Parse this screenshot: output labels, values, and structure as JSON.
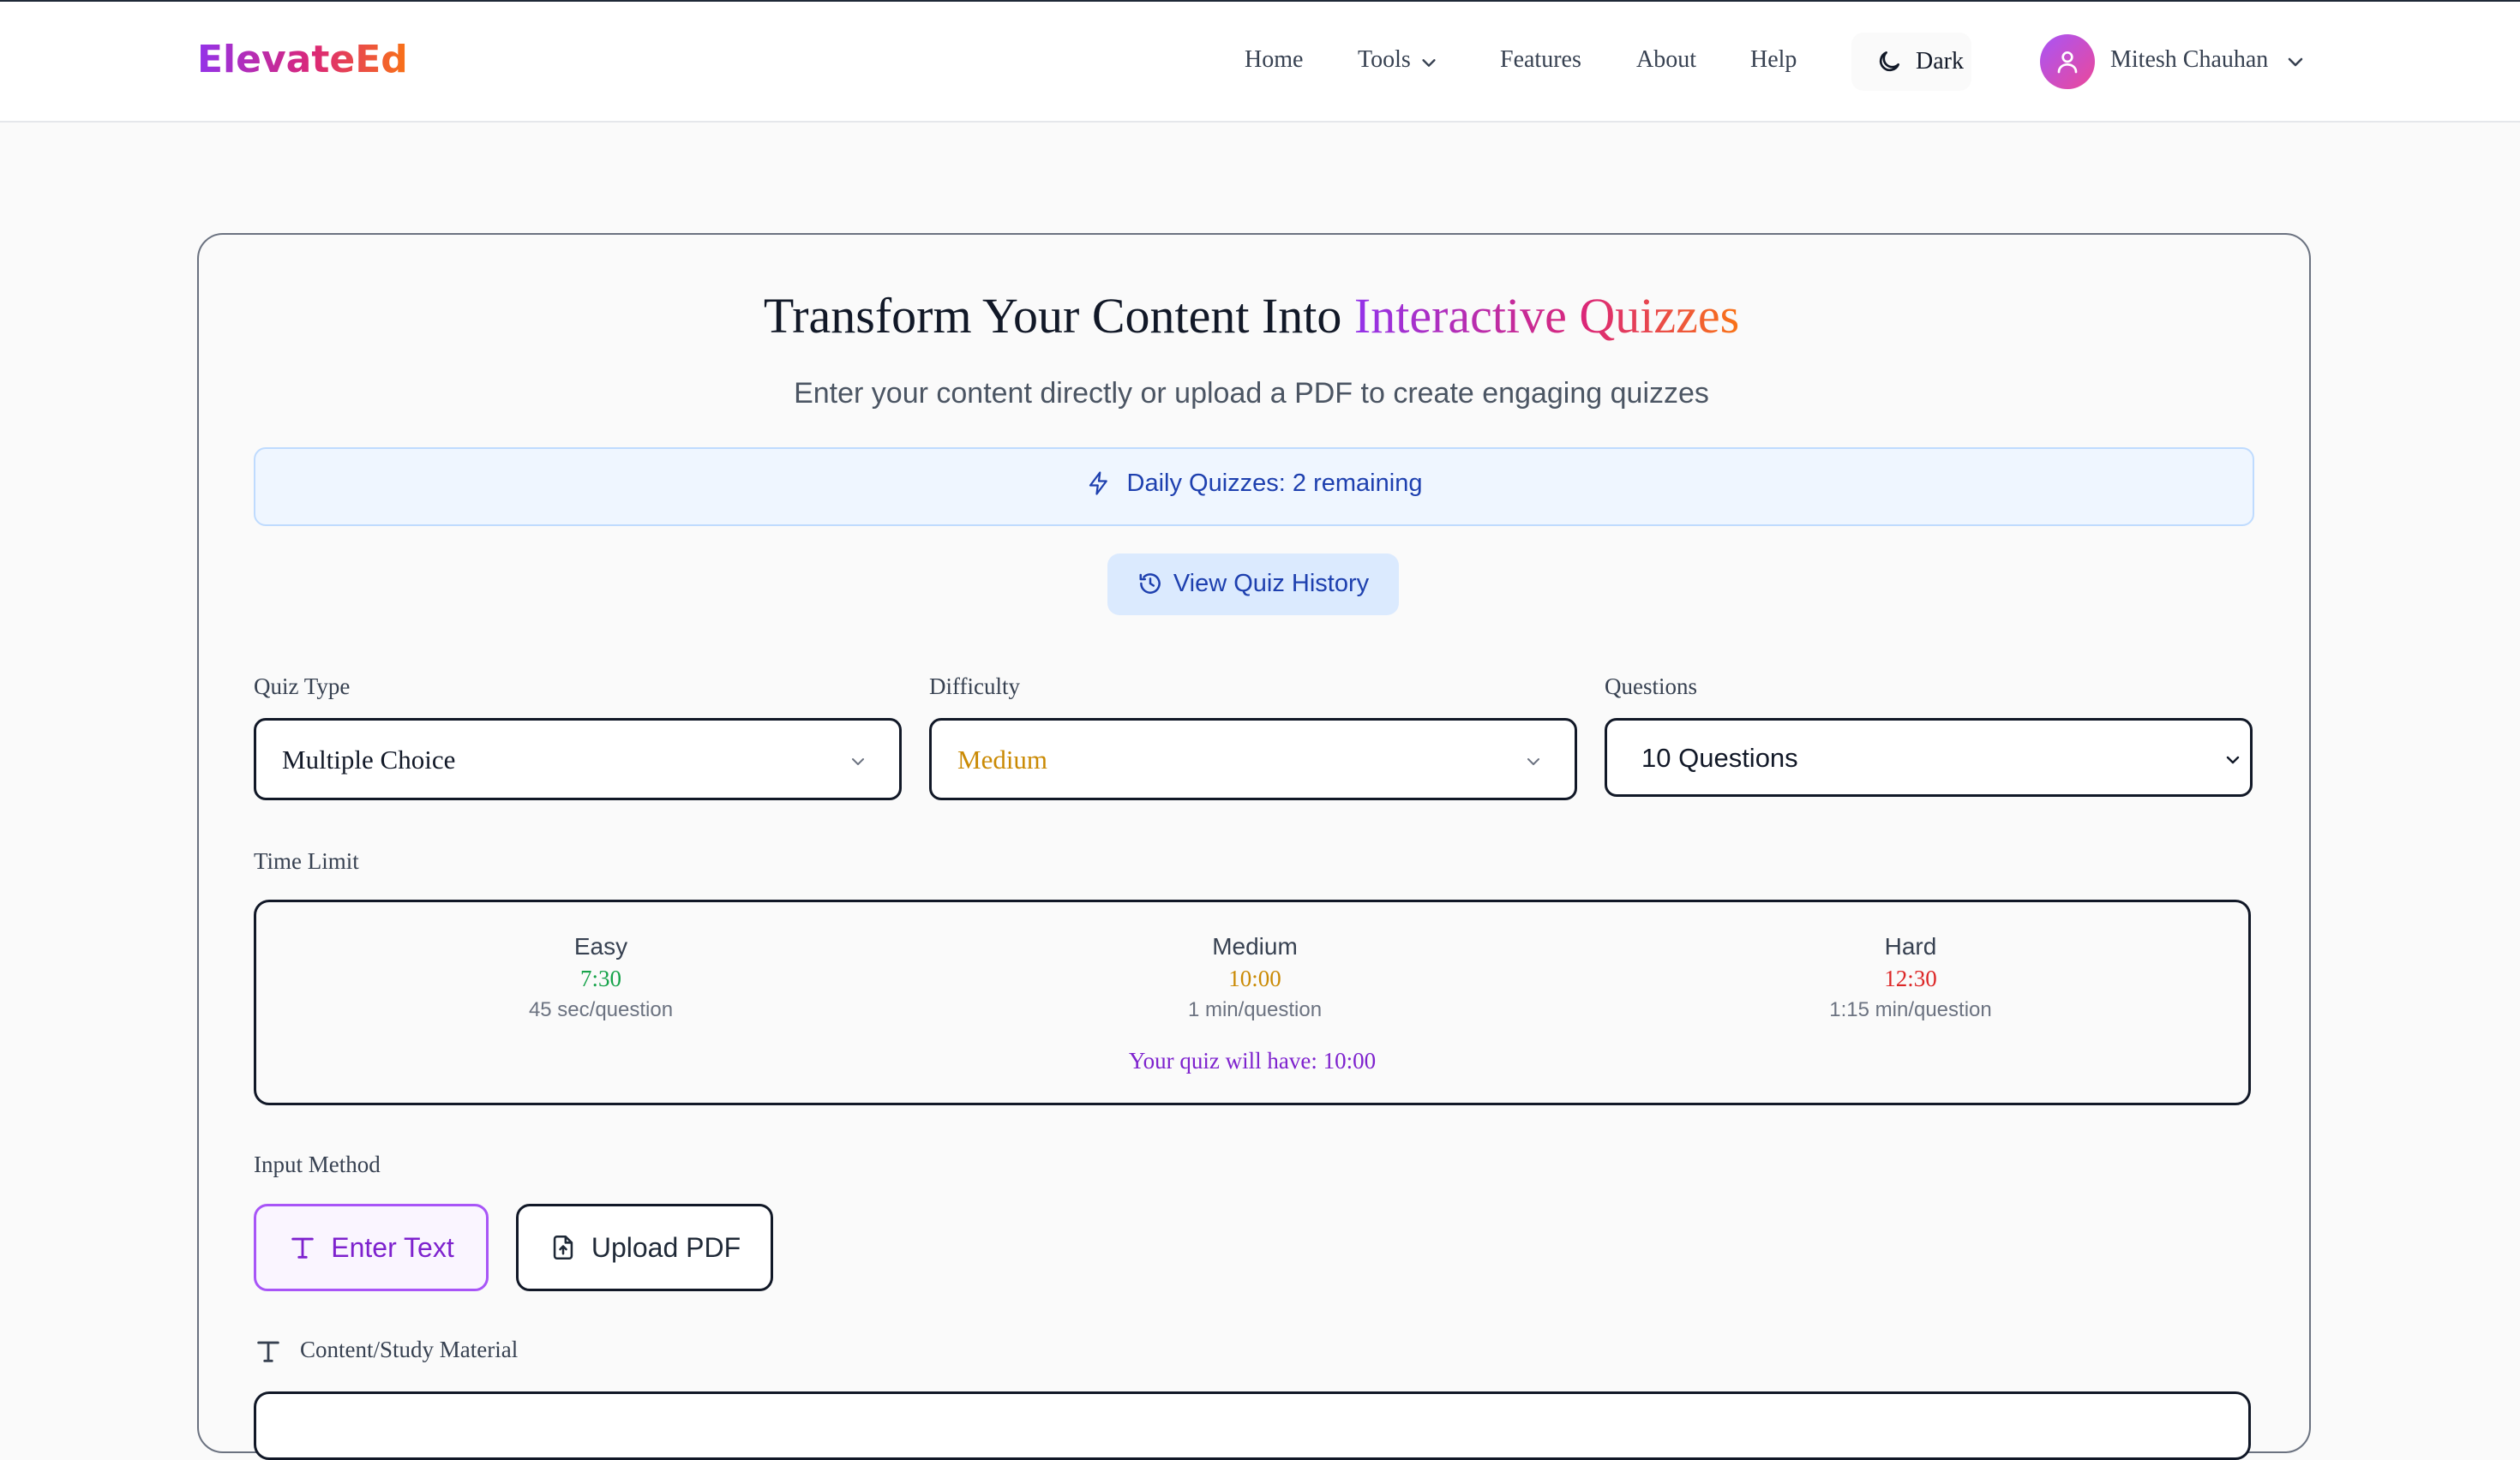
{
  "header": {
    "logo": "ElevateEd",
    "nav": {
      "home": "Home",
      "tools": "Tools",
      "features": "Features",
      "about": "About",
      "help": "Help"
    },
    "theme_toggle": "Dark",
    "user_name": "Mitesh Chauhan"
  },
  "hero": {
    "title_plain": "Transform Your Content Into ",
    "title_highlight": "Interactive Quizzes",
    "subtitle": "Enter your content directly or upload a PDF to create engaging quizzes"
  },
  "daily_quota": "Daily Quizzes: 2 remaining",
  "history_button": "View Quiz History",
  "settings": {
    "quiz_type": {
      "label": "Quiz Type",
      "value": "Multiple Choice"
    },
    "difficulty": {
      "label": "Difficulty",
      "value": "Medium",
      "value_color": "#ca8a04"
    },
    "questions": {
      "label": "Questions",
      "value": "10 Questions"
    }
  },
  "time_limit": {
    "label": "Time Limit",
    "levels": [
      {
        "name": "Easy",
        "time": "7:30",
        "rate": "45 sec/question",
        "color": "#16a34a"
      },
      {
        "name": "Medium",
        "time": "10:00",
        "rate": "1 min/question",
        "color": "#ca8a04"
      },
      {
        "name": "Hard",
        "time": "12:30",
        "rate": "1:15 min/question",
        "color": "#dc2626"
      }
    ],
    "summary": "Your quiz will have: 10:00"
  },
  "input_method": {
    "label": "Input Method",
    "enter_text": "Enter Text",
    "upload_pdf": "Upload PDF",
    "selected": "Enter Text"
  },
  "content_label": "Content/Study Material",
  "colors": {
    "accent": "#7e22ce",
    "info_bg": "#eff6ff",
    "info_text": "#1e40af"
  }
}
